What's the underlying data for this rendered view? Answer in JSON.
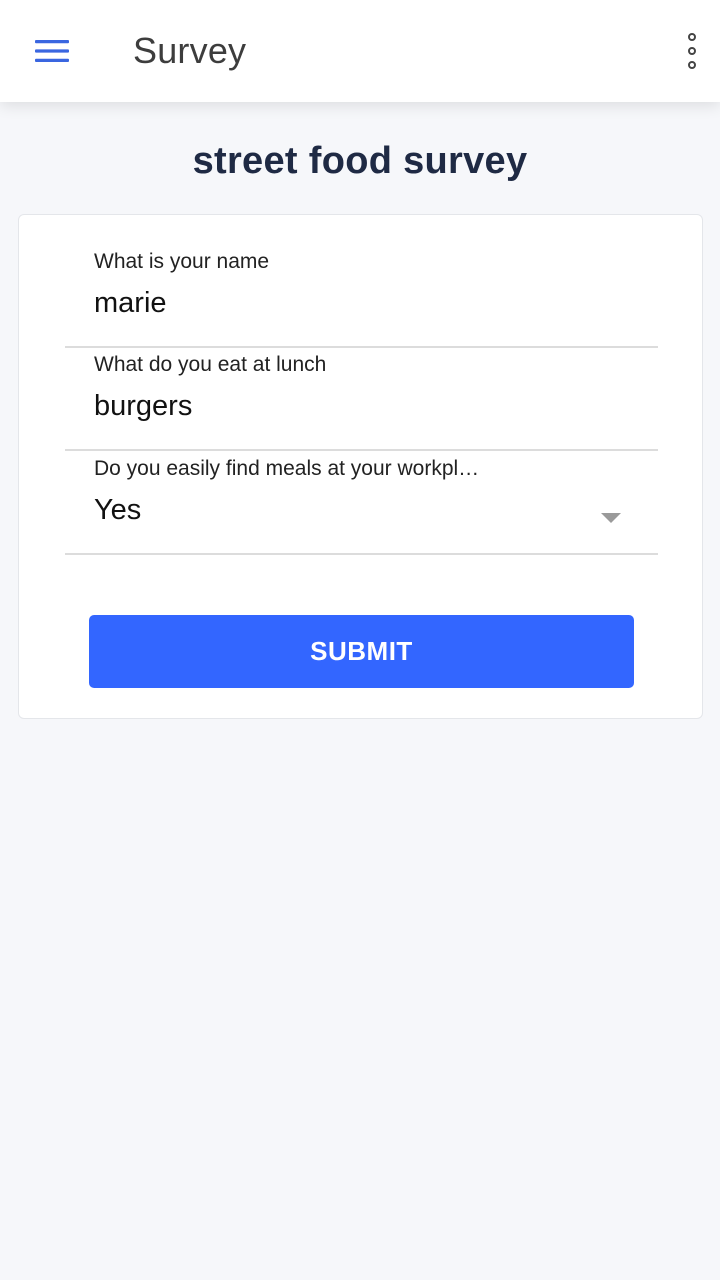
{
  "app_bar": {
    "title": "Survey",
    "menu_icon": "hamburger-menu-icon",
    "overflow_icon": "more-vertical-icon",
    "accent_color": "#3a66e0"
  },
  "page": {
    "heading": "street food survey"
  },
  "form": {
    "fields": [
      {
        "label": "What is your name",
        "value": "marie"
      },
      {
        "label": "What do you eat at lunch",
        "value": "burgers"
      },
      {
        "label": "Do you easily find meals at your workpl…",
        "value": "Yes",
        "control": "dropdown"
      }
    ],
    "submit_label": "SUBMIT",
    "submit_color": "#3366ff"
  }
}
